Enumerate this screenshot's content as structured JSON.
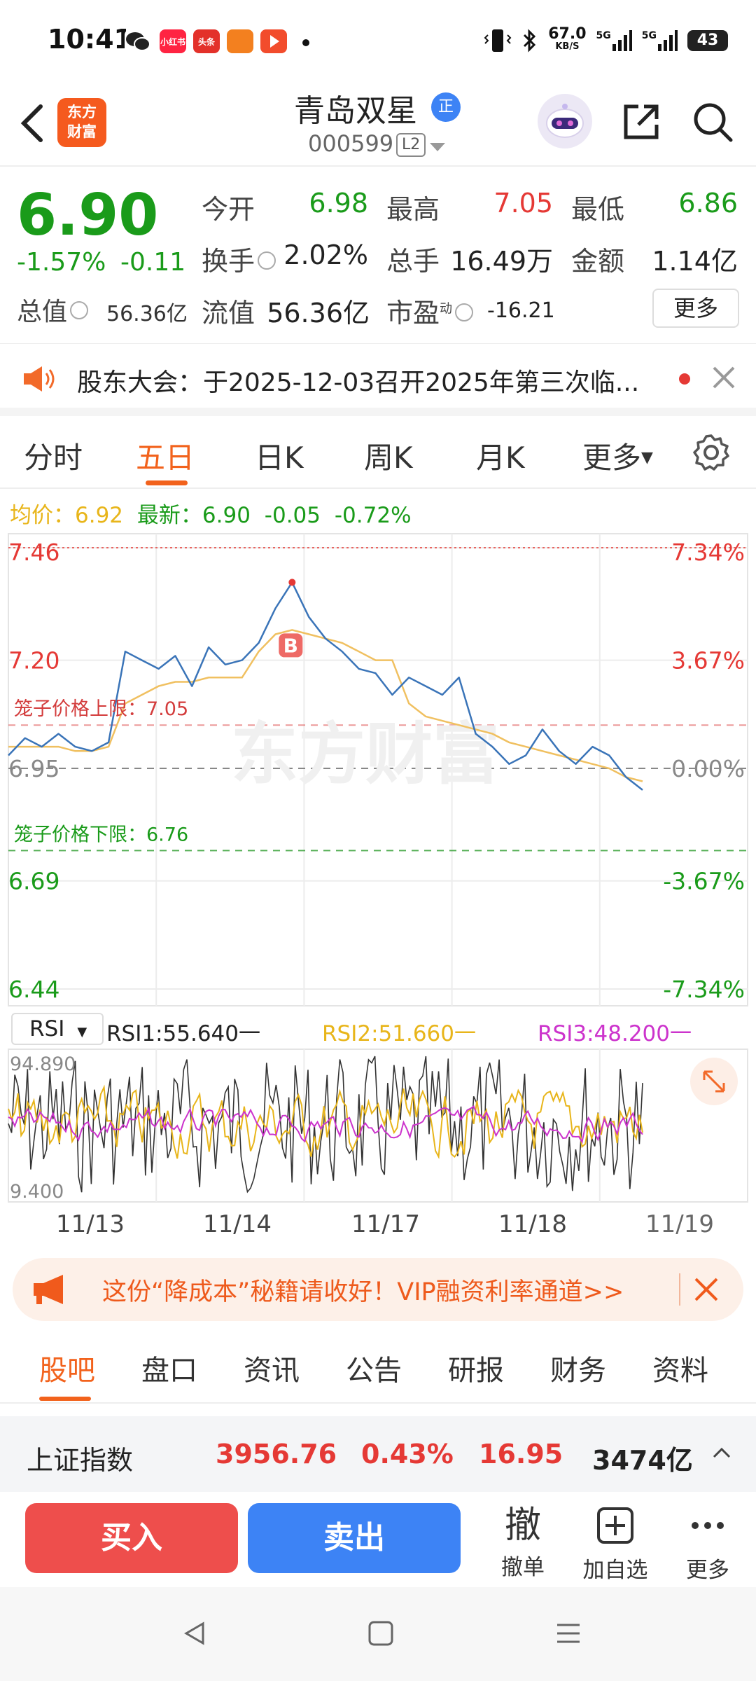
{
  "status": {
    "time": "10:41",
    "net_speed_value": "67.0",
    "net_speed_unit": "KB/S",
    "signal1": "5G",
    "signal2": "5G",
    "battery": "43",
    "apps": [
      {
        "icon": "wechat-icon",
        "color": "#222222",
        "label": ""
      },
      {
        "icon": "xiaohongshu-icon",
        "color": "#ff2442",
        "label": "小红书"
      },
      {
        "icon": "toutiao-icon",
        "color": "#e3312a",
        "label": "头条"
      },
      {
        "icon": "app-icon",
        "color": "#f3801f",
        "label": ""
      },
      {
        "icon": "video-icon",
        "color": "#f24c2c",
        "label": ""
      }
    ]
  },
  "header": {
    "logo_line1": "东方",
    "logo_line2": "财富",
    "stock_name": "青岛双星",
    "badge": "正",
    "stock_code": "000599",
    "level": "L2"
  },
  "quote": {
    "price": "6.90",
    "change_pct": "-1.57%",
    "change_amt": "-0.11",
    "total_value_label": "总值",
    "total_value": "56.36亿",
    "open_label": "今开",
    "open": "6.98",
    "high_label": "最高",
    "high": "7.05",
    "low_label": "最低",
    "low": "6.86",
    "turnover_label": "换手",
    "turnover": "2.02%",
    "volume_label": "总手",
    "volume": "16.49万",
    "amount_label": "金额",
    "amount": "1.14亿",
    "float_label": "流值",
    "float_value": "56.36亿",
    "pe_label": "市盈",
    "pe_sup": "动",
    "pe": "-16.21",
    "more": "更多"
  },
  "notice": {
    "text": "股东大会：于2025-12-03召开2025年第三次临..."
  },
  "tabs": [
    {
      "label": "分时",
      "active": false
    },
    {
      "label": "五日",
      "active": true
    },
    {
      "label": "日K",
      "active": false
    },
    {
      "label": "周K",
      "active": false
    },
    {
      "label": "月K",
      "active": false
    },
    {
      "label": "更多",
      "active": false
    }
  ],
  "avg": {
    "avg_label": "均价：",
    "avg_value": "6.92",
    "latest_label": "最新：",
    "latest_value": "6.90",
    "latest_change": "-0.05",
    "latest_pct": "-0.72%"
  },
  "chart": {
    "y_labels_left": [
      "7.46",
      "7.20",
      "6.95",
      "6.69",
      "6.44"
    ],
    "y_labels_right": [
      "7.34%",
      "3.67%",
      "0.00%",
      "-3.67%",
      "-7.34%"
    ],
    "upper_limit_label": "笼子价格上限：7.05",
    "lower_limit_label": "笼子价格下限：6.76",
    "watermark": "东方财富",
    "marker": "B"
  },
  "rsi": {
    "selector": "RSI",
    "rsi1": "RSI1:55.640",
    "rsi2": "RSI2:51.660",
    "rsi3": "RSI3:48.200",
    "max": "94.890",
    "min": "9.400",
    "dates": [
      "11/13",
      "11/14",
      "11/17",
      "11/18",
      "11/19"
    ]
  },
  "chart_data": {
    "type": "line",
    "title": "",
    "x": [
      "11/13",
      "11/14",
      "11/17",
      "11/18",
      "11/19"
    ],
    "ylim": [
      6.44,
      7.46
    ],
    "prev_close": 6.95,
    "upper_limit": 7.05,
    "lower_limit": 6.76,
    "series": [
      {
        "values": [
          6.98,
          7.02,
          7.0,
          7.03,
          7.0,
          6.99,
          7.01,
          7.22,
          7.2,
          7.18,
          7.21,
          7.14,
          7.23,
          7.19,
          7.2,
          7.24,
          7.32,
          7.38,
          7.3,
          7.25,
          7.22,
          7.18,
          7.17,
          7.12,
          7.16,
          7.14,
          7.12,
          7.16,
          7.03,
          7.0,
          6.96,
          6.98,
          7.04,
          6.99,
          6.96,
          7.0,
          6.98,
          6.93,
          6.9
        ]
      },
      {
        "values": [
          7.0,
          7.0,
          7.0,
          7.0,
          6.99,
          6.99,
          7.0,
          7.1,
          7.12,
          7.14,
          7.15,
          7.15,
          7.16,
          7.16,
          7.16,
          7.22,
          7.26,
          7.27,
          7.26,
          7.25,
          7.24,
          7.22,
          7.2,
          7.2,
          7.1,
          7.07,
          7.06,
          7.05,
          7.04,
          7.03,
          7.01,
          7.0,
          6.99,
          6.98,
          6.97,
          6.96,
          6.95,
          6.93,
          6.92
        ]
      }
    ]
  },
  "vip": {
    "text": "这份“降成本”秘籍请收好！VIP融资利率通道>>"
  },
  "bottom_tabs": [
    {
      "label": "股吧",
      "active": true
    },
    {
      "label": "盘口",
      "active": false
    },
    {
      "label": "资讯",
      "active": false
    },
    {
      "label": "公告",
      "active": false
    },
    {
      "label": "研报",
      "active": false
    },
    {
      "label": "财务",
      "active": false
    },
    {
      "label": "资料",
      "active": false
    }
  ],
  "index": {
    "name": "上证指数",
    "value": "3956.76",
    "pct": "0.43%",
    "change": "16.95",
    "amount": "3474亿"
  },
  "actions": {
    "buy": "买入",
    "sell": "卖出",
    "cancel_glyph": "撤",
    "cancel": "撤单",
    "add": "加自选",
    "more": "更多"
  },
  "colors": {
    "up": "#e53935",
    "down": "#1a9b1a",
    "accent": "#f2621c",
    "price_line": "#3a74b8",
    "avg_line": "#f0c060",
    "rsi2": "#e8b51a",
    "rsi3": "#cc33cc"
  }
}
